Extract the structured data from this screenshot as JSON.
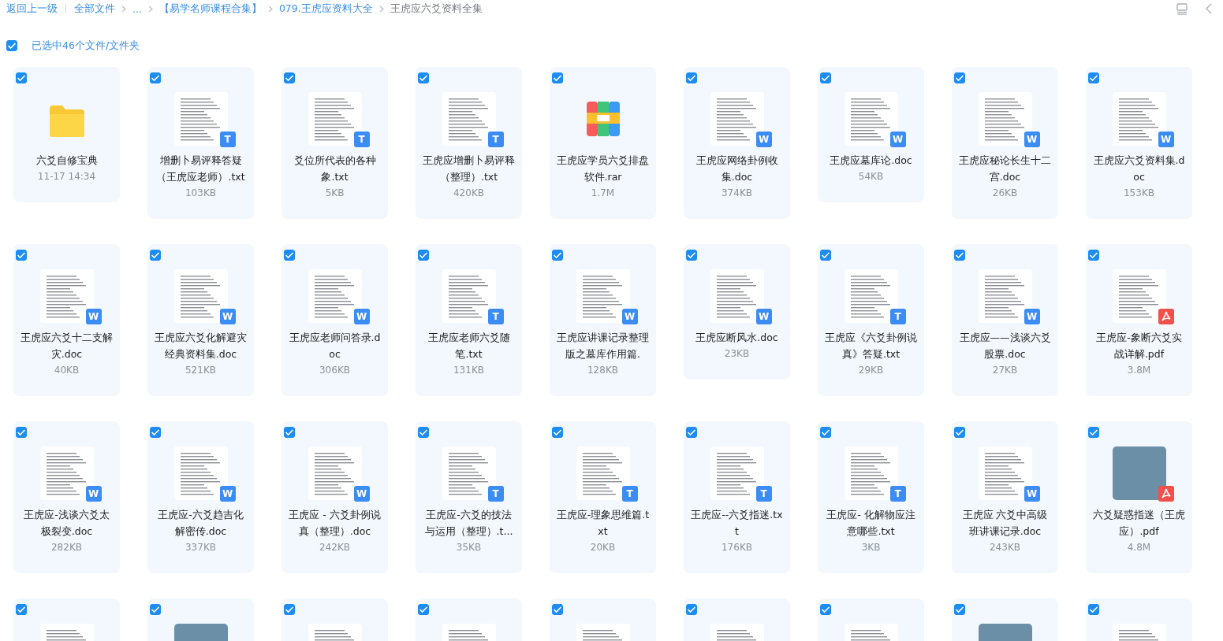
{
  "breadcrumb": {
    "back": "返回上一级",
    "items": [
      {
        "label": "全部文件",
        "current": false
      },
      {
        "label": "...",
        "current": false
      },
      {
        "label": "【易学名师课程合集】",
        "current": false
      },
      {
        "label": "079.王虎应资料大全",
        "current": false
      },
      {
        "label": "王虎应六爻资料全集",
        "current": true
      }
    ]
  },
  "selection": {
    "checked": true,
    "label": "已选中46个文件/文件夹"
  },
  "files": [
    {
      "kind": "folder",
      "name": "六爻自修宝典",
      "meta": "11-17 14:34",
      "checked": true
    },
    {
      "kind": "txt",
      "badge_label": "T",
      "name": "增删卜易评释答疑（王虎应老师）.txt",
      "meta": "103KB",
      "checked": true
    },
    {
      "kind": "txt",
      "badge_label": "T",
      "name": "爻位所代表的各种象.txt",
      "meta": "5KB",
      "checked": true
    },
    {
      "kind": "txt",
      "badge_label": "T",
      "name": "王虎应增删卜易评释（整理）.txt",
      "meta": "420KB",
      "checked": true
    },
    {
      "kind": "rar",
      "name": "王虎应学员六爻排盘软件.rar",
      "meta": "1.7M",
      "checked": true
    },
    {
      "kind": "doc",
      "badge_label": "W",
      "name": "王虎应网络卦例收集.doc",
      "meta": "374KB",
      "checked": true
    },
    {
      "kind": "doc",
      "badge_label": "W",
      "name": "王虎应墓库论.doc",
      "meta": "54KB",
      "checked": true
    },
    {
      "kind": "doc",
      "badge_label": "W",
      "name": "王虎应秘论长生十二宫.doc",
      "meta": "26KB",
      "checked": true
    },
    {
      "kind": "doc",
      "badge_label": "W",
      "name": "王虎应六爻资料集.doc",
      "meta": "153KB",
      "checked": true
    },
    {
      "kind": "doc",
      "badge_label": "W",
      "name": "王虎应六爻十二支解灾.doc",
      "meta": "40KB",
      "checked": true
    },
    {
      "kind": "doc",
      "badge_label": "W",
      "name": "王虎应六爻化解避灾经典资料集.doc",
      "meta": "521KB",
      "checked": true
    },
    {
      "kind": "doc",
      "badge_label": "W",
      "name": "王虎应老师问答录.doc",
      "meta": "306KB",
      "checked": true
    },
    {
      "kind": "txt",
      "badge_label": "T",
      "name": "王虎应老师六爻随笔.txt",
      "meta": "131KB",
      "checked": true
    },
    {
      "kind": "doc",
      "badge_label": "W",
      "name": "王虎应讲课记录整理版之墓库作用篇.",
      "meta": "128KB",
      "checked": true
    },
    {
      "kind": "doc",
      "badge_label": "W",
      "name": "王虎应断风水.doc",
      "meta": "23KB",
      "checked": true
    },
    {
      "kind": "txt",
      "badge_label": "T",
      "name": "王虎应《六爻卦例说真》答疑.txt",
      "meta": "29KB",
      "checked": true
    },
    {
      "kind": "doc",
      "badge_label": "W",
      "name": "王虎应——浅谈六爻股票.doc",
      "meta": "27KB",
      "checked": true
    },
    {
      "kind": "pdf",
      "name": "王虎应-象断六爻实战详解.pdf",
      "meta": "3.8M",
      "checked": true
    },
    {
      "kind": "doc",
      "badge_label": "W",
      "name": "王虎应-浅谈六爻太极裂变.doc",
      "meta": "282KB",
      "checked": true
    },
    {
      "kind": "doc",
      "badge_label": "W",
      "name": "王虎应-六爻趋吉化解密传.doc",
      "meta": "337KB",
      "checked": true
    },
    {
      "kind": "doc",
      "badge_label": "W",
      "name": "王虎应 - 六爻卦例说真（整理）.doc",
      "meta": "242KB",
      "checked": true
    },
    {
      "kind": "txt",
      "badge_label": "T",
      "name": "王虎应-六爻的技法与运用（整理）.t...",
      "meta": "35KB",
      "checked": true
    },
    {
      "kind": "txt",
      "badge_label": "T",
      "name": "王虎应-理象思维篇.txt",
      "meta": "20KB",
      "checked": true
    },
    {
      "kind": "txt",
      "badge_label": "T",
      "name": "王虎应--六爻指迷.txt",
      "meta": "176KB",
      "checked": true
    },
    {
      "kind": "txt",
      "badge_label": "T",
      "name": "王虎应- 化解物应注意哪些.txt",
      "meta": "3KB",
      "checked": true
    },
    {
      "kind": "doc",
      "badge_label": "W",
      "name": "王虎应 六爻中高级班讲课记录.doc",
      "meta": "243KB",
      "checked": true
    },
    {
      "kind": "book",
      "name": "六爻疑惑指迷（王虎应）.pdf",
      "meta": "4.8M",
      "checked": true
    },
    {
      "kind": "page",
      "checked": true
    },
    {
      "kind": "cover",
      "checked": true
    },
    {
      "kind": "page",
      "checked": true
    },
    {
      "kind": "page",
      "checked": true
    },
    {
      "kind": "page",
      "checked": true
    },
    {
      "kind": "page",
      "checked": true
    },
    {
      "kind": "page",
      "checked": true
    },
    {
      "kind": "cover",
      "checked": true
    },
    {
      "kind": "page",
      "checked": true
    }
  ]
}
